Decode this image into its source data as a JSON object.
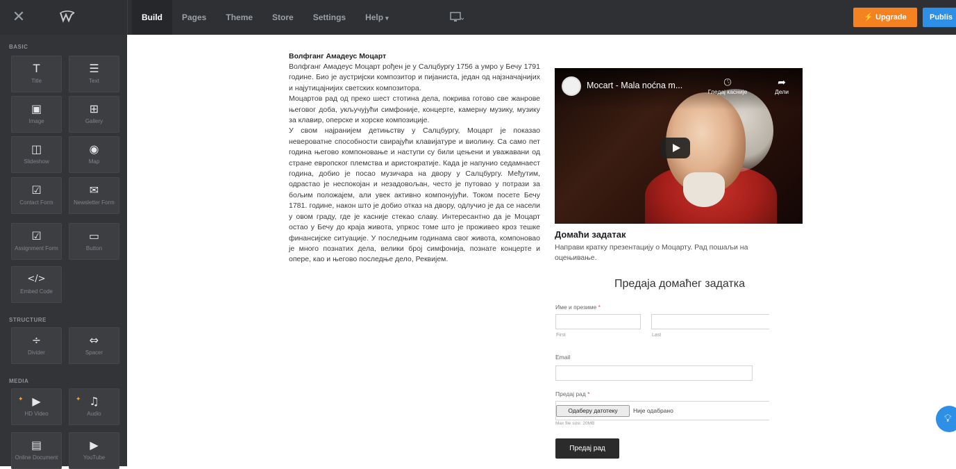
{
  "topbar": {
    "tabs": [
      {
        "label": "Build"
      },
      {
        "label": "Pages"
      },
      {
        "label": "Theme"
      },
      {
        "label": "Store"
      },
      {
        "label": "Settings"
      },
      {
        "label": "Help"
      }
    ],
    "upgrade_label": "⚡ Upgrade",
    "publish_label": "Publis",
    "icons": {
      "close": "close-icon",
      "logo": "weebly-logo-icon",
      "device": "desktop-icon"
    }
  },
  "sidebar": {
    "sections": {
      "basic": "BASIC",
      "structure": "STRUCTURE",
      "media": "MEDIA"
    },
    "tiles": [
      {
        "icon": "T",
        "label": "Title"
      },
      {
        "icon": "☰",
        "label": "Text"
      },
      {
        "icon": "▣",
        "label": "Image"
      },
      {
        "icon": "⊞",
        "label": "Gallery"
      },
      {
        "icon": "◫",
        "label": "Slideshow"
      },
      {
        "icon": "◉",
        "label": "Map"
      },
      {
        "icon": "☑",
        "label": "Contact Form"
      },
      {
        "icon": "✉",
        "label": "Newsletter Form"
      },
      {
        "icon": "☑",
        "label": "Assignment Form"
      },
      {
        "icon": "▭",
        "label": "Button"
      },
      {
        "icon": "</>",
        "label": "Embed Code"
      },
      {
        "icon": "÷",
        "label": "Divider"
      },
      {
        "icon": "⇔",
        "label": "Spacer"
      },
      {
        "icon": "▶",
        "label": "HD Video"
      },
      {
        "icon": "♫",
        "label": "Audio"
      },
      {
        "icon": "▤",
        "label": "Online Document"
      },
      {
        "icon": "▶",
        "label": "YouTube"
      }
    ]
  },
  "article": {
    "title": "Волфганг Амадеус Моцарт",
    "paragraphs": [
      "Волфганг Амадеус Моцарт рођен је у Салцбургу 1756 а умро у Бечу 1791 године. Био је аустријски композитор и пијаниста, један од најзначајнијих и најутицајнијих светских композитора.",
      "Моцартов рад од преко шест стотина дела, покрива готово све жанрове његовог доба, укључујући симфоније, концерте, камерну музику, музику за клавир, оперске и хорске композиције.",
      "У свом најранијем детињству у Салцбургу, Моцарт је показао невероватне способности свирајући клавијатуре и виолину. Са само пет година његово компоновање и наступи су били цењени и уважавани од стране европског племства и аристократије. Када је напунио седамнаест година, добио је посао музичара на двору у Салцбургу. Међутим, одрастао је неспокојан и незадовољан, често је путовао у потрази за бољим положајем, али увек активно компонујући. Током посете Бечу 1781. године, након што је добио отказ на двору, одлучио је да се насели у овом граду, где је касније стекао славу. Интересантно да је Моцарт остао у Бечу до краја живота, упркос томе што је проживео кроз тешке финансијске ситуације. У последњим годинама свог живота, компоновао је много познатих дела, велики број симфонија, познате концерте и опере, као и његово последње дело, Реквијем."
    ]
  },
  "video": {
    "title": "Mocart - Mala noćna m...",
    "watch_later": "Гледај касније",
    "share": "Дели"
  },
  "homework": {
    "title": "Домаћи задатак",
    "description": "Направи кратку презентацију о Моцарту. Рад пошаљи на оцењивање."
  },
  "form": {
    "heading": "Предаја домаћег задатка",
    "name_label": "Име и презиме",
    "required_mark": "*",
    "first_sub": "First",
    "last_sub": "Last",
    "email_label": "Email",
    "upload_label": "Предај рад",
    "file_button": "Одаберу датотеку",
    "file_status": "Није одабрано",
    "file_note": "Max file size: 20MB",
    "submit_label": "Предај рад"
  },
  "colors": {
    "upgrade": "#f58220",
    "publish": "#2d8fe5",
    "sidebar": "#333437",
    "topbar": "#2f3033"
  }
}
